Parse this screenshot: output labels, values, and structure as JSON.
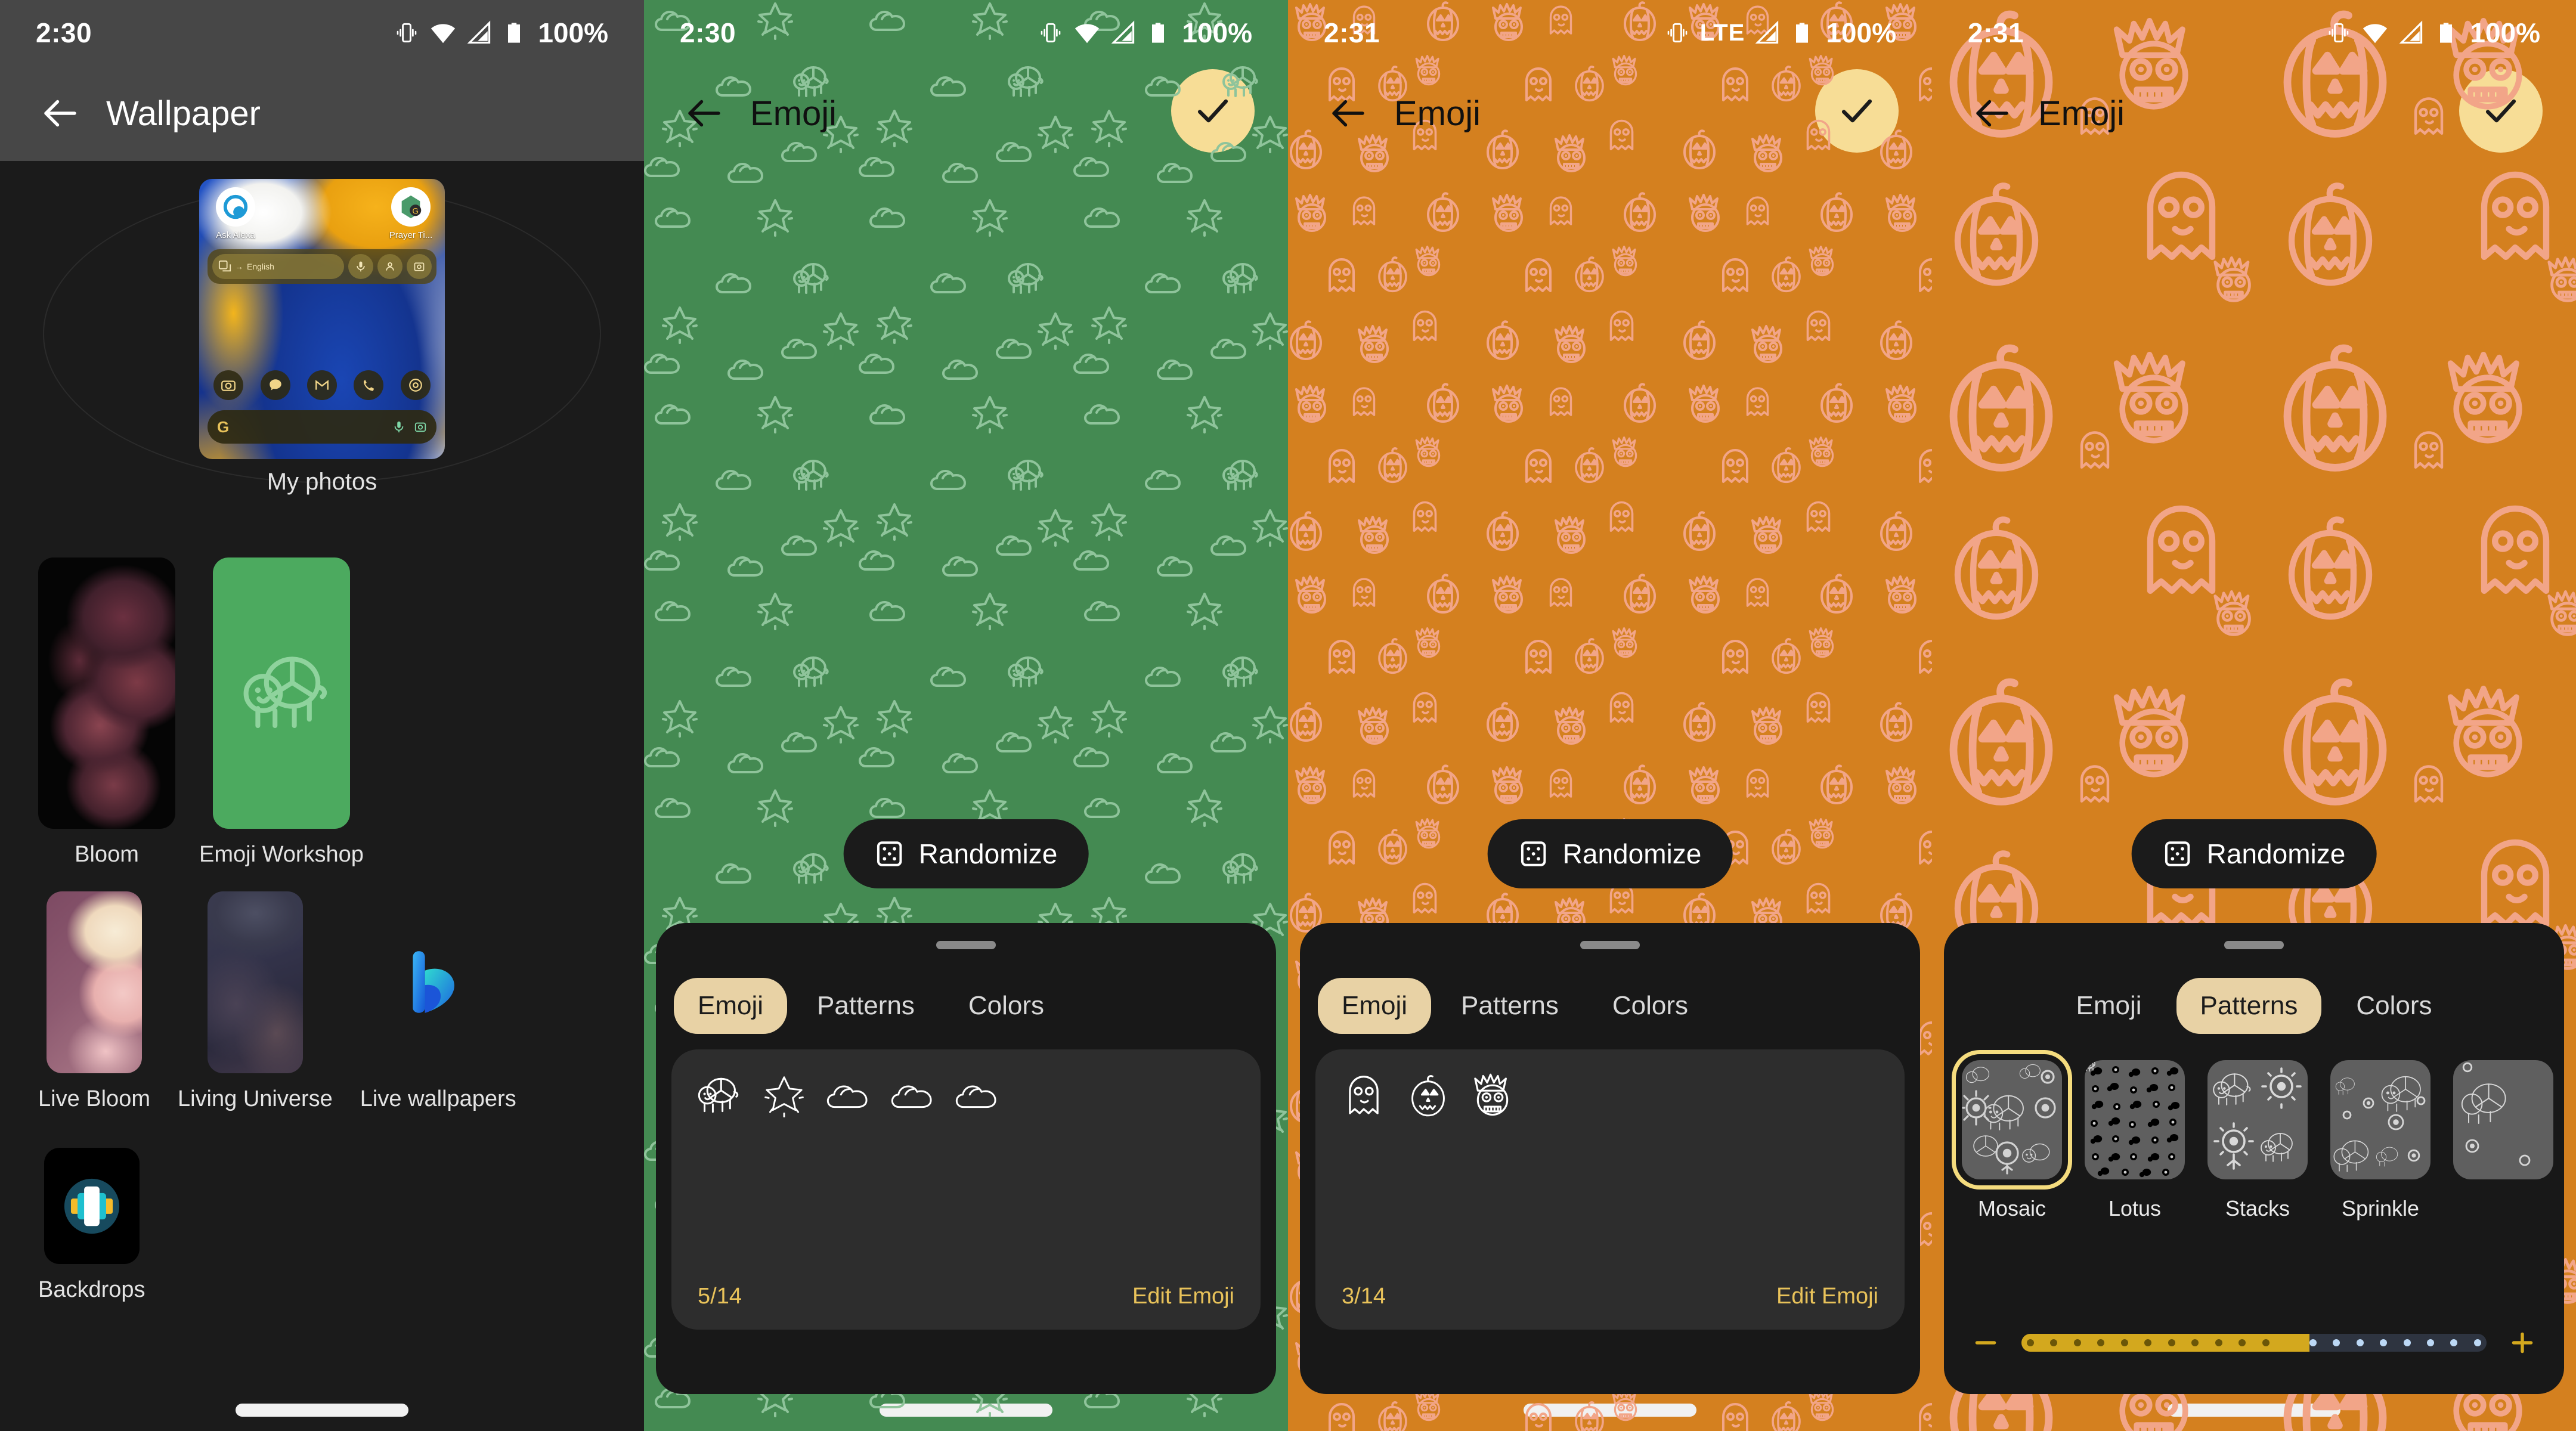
{
  "panels": [
    {
      "id": "wallpaper-picker",
      "statusbar": {
        "time": "2:30",
        "battery": "100%",
        "network": "wifi",
        "icons": [
          "vibrate-icon",
          "wifi-icon",
          "signal-icon",
          "battery-icon"
        ]
      },
      "appbar": {
        "back": "back-arrow",
        "title": "Wallpaper"
      },
      "hero": {
        "label": "My photos",
        "apps": [
          {
            "name": "Ask Alexa"
          },
          {
            "name": "Prayer Ti..."
          }
        ],
        "widget": {
          "translate_label": "English",
          "arrow": "→"
        },
        "search": {
          "logo": "G"
        }
      },
      "grid": [
        {
          "label": "Bloom",
          "kind": "photo"
        },
        {
          "label": "Emoji Workshop",
          "kind": "emoji-workshop"
        },
        {
          "label": "Live Bloom",
          "kind": "photo"
        },
        {
          "label": "Living Universe",
          "kind": "photo"
        },
        {
          "label": "Live wallpapers",
          "kind": "live-wallpapers"
        },
        {
          "label": "Backdrops",
          "kind": "backdrops"
        }
      ]
    },
    {
      "id": "emoji-green",
      "statusbar": {
        "time": "2:30",
        "battery": "100%",
        "network": "wifi",
        "icons": [
          "vibrate-icon",
          "wifi-icon",
          "signal-icon",
          "battery-icon"
        ]
      },
      "appbar": {
        "back": "back-arrow",
        "title": "Emoji",
        "confirm": "check-icon"
      },
      "wallpaper": {
        "bg_color": "#448a52",
        "motif_color": "#8fc49b",
        "motifs": [
          "turtle",
          "star",
          "cloud"
        ]
      },
      "randomize": {
        "label": "Randomize",
        "icon": "dice-icon"
      },
      "sheet": {
        "tabs": [
          {
            "label": "Emoji",
            "active": true
          },
          {
            "label": "Patterns",
            "active": false
          },
          {
            "label": "Colors",
            "active": false
          }
        ],
        "emoji": {
          "items": [
            "turtle",
            "sparkle-star",
            "cloud",
            "cloud",
            "cloud"
          ],
          "count": "5/14",
          "edit_label": "Edit Emoji"
        }
      }
    },
    {
      "id": "emoji-orange",
      "statusbar": {
        "time": "2:31",
        "battery": "100%",
        "network": "lte",
        "lte_label": "LTE",
        "icons": [
          "vibrate-icon",
          "lte-label",
          "signal-icon",
          "battery-icon"
        ]
      },
      "appbar": {
        "back": "back-arrow",
        "title": "Emoji",
        "confirm": "check-icon"
      },
      "wallpaper": {
        "bg_color": "#d4801f",
        "motif_color": "#f2a588",
        "motifs": [
          "pumpkin",
          "ghost",
          "ogre"
        ]
      },
      "randomize": {
        "label": "Randomize",
        "icon": "dice-icon"
      },
      "sheet": {
        "tabs": [
          {
            "label": "Emoji",
            "active": true
          },
          {
            "label": "Patterns",
            "active": false
          },
          {
            "label": "Colors",
            "active": false
          }
        ],
        "emoji": {
          "items": [
            "ghost",
            "pumpkin",
            "ogre"
          ],
          "count": "3/14",
          "edit_label": "Edit Emoji"
        }
      }
    },
    {
      "id": "patterns-orange",
      "statusbar": {
        "time": "2:31",
        "battery": "100%",
        "network": "wifi",
        "icons": [
          "vibrate-icon",
          "wifi-icon",
          "signal-icon",
          "battery-icon"
        ]
      },
      "appbar": {
        "back": "back-arrow",
        "title": "Emoji",
        "confirm": "check-icon"
      },
      "wallpaper": {
        "bg_color": "#d4801f",
        "motif_color": "#f2a588",
        "motifs": [
          "pumpkin",
          "ghost",
          "ogre"
        ],
        "scale": "large"
      },
      "randomize": {
        "label": "Randomize",
        "icon": "dice-icon"
      },
      "sheet": {
        "tabs": [
          {
            "label": "Emoji",
            "active": false
          },
          {
            "label": "Patterns",
            "active": true
          },
          {
            "label": "Colors",
            "active": false
          }
        ],
        "patterns": [
          {
            "name": "Mosaic",
            "selected": true,
            "density": "large"
          },
          {
            "name": "Lotus",
            "selected": false,
            "density": "tiny"
          },
          {
            "name": "Stacks",
            "selected": false,
            "density": "xl"
          },
          {
            "name": "Sprinkle",
            "selected": false,
            "density": "mixed"
          },
          {
            "name": "",
            "selected": false,
            "density": "mixed"
          }
        ],
        "slider": {
          "value_percent": 58,
          "minus": "−",
          "plus": "+"
        }
      }
    }
  ],
  "colors": {
    "accent_yellow": "#f7dd96",
    "tab_active": "#e8d2a5",
    "gold_text": "#e8c25a",
    "slider_fill": "#d3a81e",
    "green_bg": "#448a52",
    "orange_bg": "#d4801f",
    "salmon": "#f2a588",
    "sheet_bg": "#181818",
    "panel1_bg": "#1b1b1b",
    "appbar_bg": "#474747"
  }
}
